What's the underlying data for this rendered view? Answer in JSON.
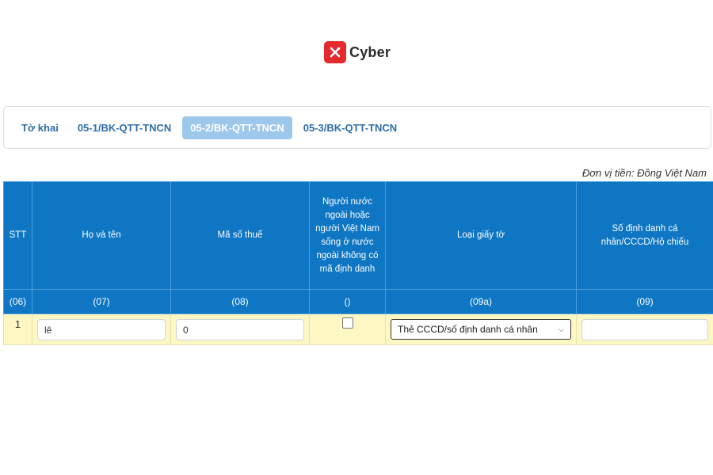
{
  "brand": {
    "name": "Cyber",
    "color": "#e42a2e"
  },
  "tabs": [
    {
      "label": "Tờ khai",
      "active": false
    },
    {
      "label": "05-1/BK-QTT-TNCN",
      "active": false
    },
    {
      "label": "05-2/BK-QTT-TNCN",
      "active": true
    },
    {
      "label": "05-3/BK-QTT-TNCN",
      "active": false
    }
  ],
  "unit_note": "Đơn vị tiền: Đồng Việt Nam",
  "table": {
    "headers": {
      "stt": "STT",
      "name": "Họ và tên",
      "tax_code": "Mã số thuế",
      "foreigner": "Người nước ngoài hoặc người Việt Nam sống ở nước ngoài không có mã định danh",
      "doc_type": "Loại giấy tờ",
      "id_number": "Số định danh cá nhân/CCCD/Hộ chiếu"
    },
    "codes": {
      "stt": "(06)",
      "name": "(07)",
      "tax_code": "(08)",
      "foreigner": "()",
      "doc_type": "(09a)",
      "id_number": "(09)"
    },
    "rows": [
      {
        "stt": "1",
        "name": "lê",
        "tax_code": "0",
        "foreigner_checked": false,
        "doc_type": "Thẻ CCCD/số định danh cá nhân",
        "id_number": ""
      }
    ]
  },
  "colors": {
    "header_bg": "#0f76c4",
    "row_bg": "#fdf7c4",
    "active_tab": "#9ec7ec",
    "tab_text": "#2e6fa8"
  }
}
